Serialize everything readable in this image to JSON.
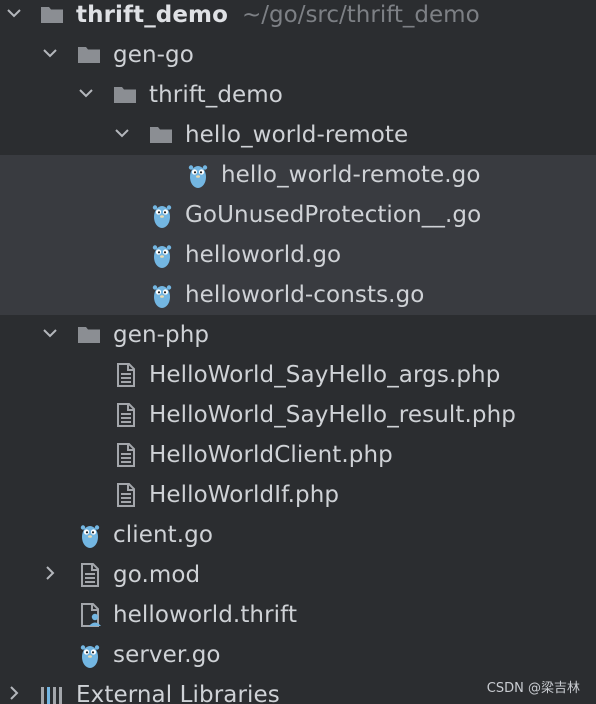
{
  "project_tree": {
    "root": {
      "name": "thrift_demo",
      "path": "~/go/src/thrift_demo"
    },
    "gen_go": {
      "name": "gen-go"
    },
    "gen_go_thrift_demo": {
      "name": "thrift_demo"
    },
    "hello_world_remote_dir": {
      "name": "hello_world-remote"
    },
    "hello_world_remote_go": {
      "name": "hello_world-remote.go"
    },
    "go_unused_protection": {
      "name": "GoUnusedProtection__.go"
    },
    "helloworld_go": {
      "name": "helloworld.go"
    },
    "helloworld_consts_go": {
      "name": "helloworld-consts.go"
    },
    "gen_php": {
      "name": "gen-php"
    },
    "php_say_hello_args": {
      "name": "HelloWorld_SayHello_args.php"
    },
    "php_say_hello_result": {
      "name": "HelloWorld_SayHello_result.php"
    },
    "php_client": {
      "name": "HelloWorldClient.php"
    },
    "php_if": {
      "name": "HelloWorldIf.php"
    },
    "client_go": {
      "name": "client.go"
    },
    "go_mod": {
      "name": "go.mod"
    },
    "helloworld_thrift": {
      "name": "helloworld.thrift"
    },
    "server_go": {
      "name": "server.go"
    },
    "external_libraries": {
      "name": "External Libraries"
    }
  },
  "watermark": "CSDN @梁吉林",
  "colors": {
    "background": "#2b2d30",
    "highlight": "#393b40",
    "text": "#cfd2d6",
    "hint": "#7d8085",
    "folder": "#8b8e93",
    "gopher": "#73b6e2"
  },
  "icons": {
    "expanded": "chevron-down-icon",
    "collapsed": "chevron-right-icon",
    "folder": "folder-icon",
    "go_file": "gopher-icon",
    "php_file": "text-file-icon",
    "thrift_file": "thrift-file-icon",
    "libraries": "libraries-icon"
  }
}
